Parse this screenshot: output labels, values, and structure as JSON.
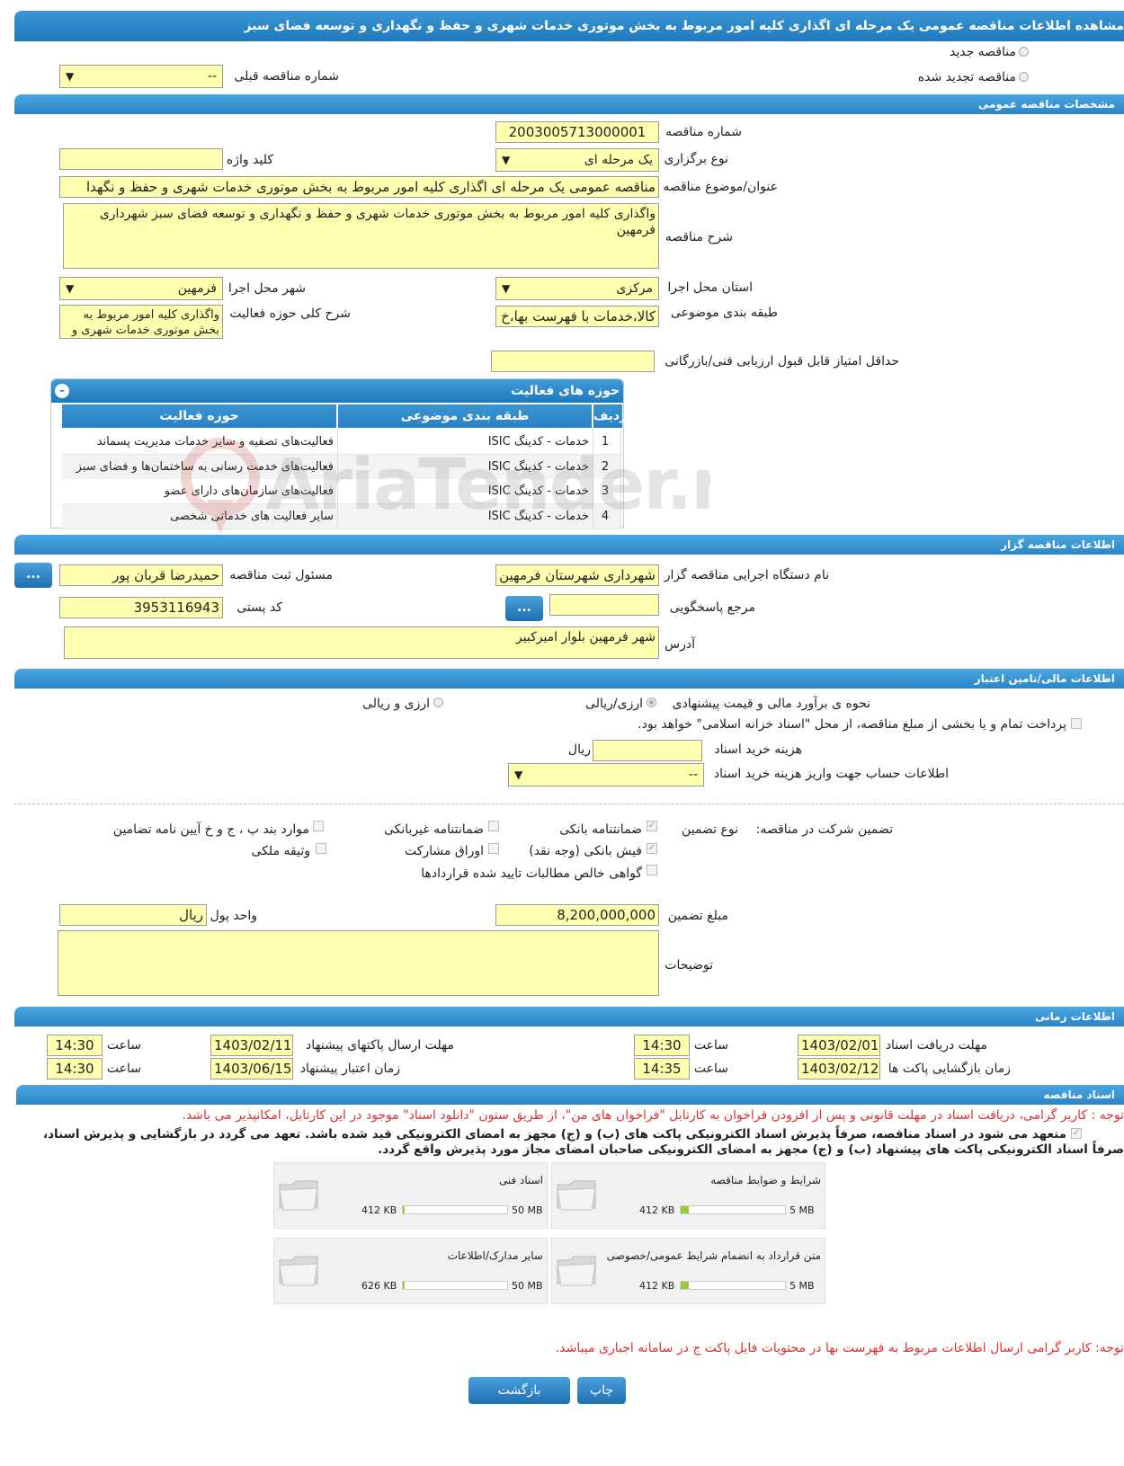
{
  "page": {
    "title": "مشاهده اطلاعات مناقصه عمومی یک مرحله ای اگذاری کلیه امور مربوط به بخش موتوری خدمات شهری و حفظ و نگهداری و توسعه فضای سبز"
  },
  "tender_type": {
    "new_label": "مناقصه جدید",
    "renewed_label": "مناقصه تجدید شده",
    "prev_number_label": "شماره مناقصه قبلی",
    "prev_number_value": "--"
  },
  "general": {
    "section_title": "مشخصات مناقصه عمومی",
    "number_label": "شماره مناقصه",
    "number_value": "2003005713000001",
    "holding_type_label": "نوع برگزاری",
    "holding_type_value": "یک مرحله ای",
    "keyword_label": "کلید واژه",
    "keyword_value": "",
    "subject_label": "عنوان/موضوع مناقصه",
    "subject_value": "مناقصه عمومی یک مرحله ای اگذاری کلیه امور مربوط به بخش موتوری خدمات شهری و حفظ و نگهدا",
    "description_label": "شرح مناقصه",
    "description_value": "واگذاری کلیه امور مربوط به بخش موتوری خدمات شهری و حفظ و نگهداری و توسعه فضای سبز شهرداری فرمهین",
    "province_label": "استان محل اجرا",
    "province_value": "مرکزی",
    "city_label": "شهر محل اجرا",
    "city_value": "فرمهین",
    "category_label": "طبقه بندی موضوعی",
    "category_value": "کالا،خدمات با فهرست بها،خ",
    "activity_desc_label": "شرح کلی حوزه فعالیت",
    "activity_desc_value": "واگذاری کلیه امور مربوط به بخش موتوری خدمات شهری و",
    "min_score_label": "حداقل امتیاز قابل قبول ارزیابی فنی/بازرگانی",
    "min_score_value": ""
  },
  "activities": {
    "title": "حوزه های فعالیت",
    "col_row": "ردیف",
    "col_category": "طبقه بندی موضوعی",
    "col_area": "حوزه فعالیت",
    "rows": [
      {
        "n": "1",
        "category": "خدمات - کدینگ ISIC",
        "area": "فعالیت‌های تصفیه و سایر خدمات مدیریت پسماند"
      },
      {
        "n": "2",
        "category": "خدمات - کدینگ ISIC",
        "area": "فعالیت‌های خدمت رسانی به ساختمان‌ها و فضای سبز"
      },
      {
        "n": "3",
        "category": "خدمات - کدینگ ISIC",
        "area": "فعالیت‌های سازمان‌های دارای عضو"
      },
      {
        "n": "4",
        "category": "خدمات - کدینگ ISIC",
        "area": "سایر فعالیت های خدماتی شخصی"
      }
    ]
  },
  "organizer": {
    "section_title": "اطلاعات مناقصه گزار",
    "org_label": "نام دستگاه اجرایی مناقصه گزار",
    "org_value": "شهرداری شهرستان فرمهین",
    "responsible_label": "مسئول ثبت مناقصه",
    "responsible_value": "حمیدرضا قربان پور",
    "more_button": "...",
    "reference_label": "مرجع پاسخگویی",
    "reference_value": "",
    "postal_label": "کد پستی",
    "postal_value": "3953116943",
    "address_label": "آدرس",
    "address_value": "شهر فرمهین بلوار امیرکبیر"
  },
  "finance": {
    "section_title": "اطلاعات مالی/تامین اعتبار",
    "estimate_label": "نحوه ی برآورد مالی و قیمت پیشنهادی",
    "option_rial": "ارزی/ریالی",
    "option_fx": "ارزی و ریالی",
    "treasury_text": "پرداخت تمام و یا بخشی از مبلغ مناقصه، از محل \"اسناد خزانه اسلامی\" خواهد بود.",
    "doc_fee_label": "هزینه خرید اسناد",
    "doc_fee_value": "",
    "doc_fee_unit": "ریال",
    "account_label": "اطلاعات حساب جهت واریز هزینه خرید اسناد",
    "account_value": "--"
  },
  "guarantee": {
    "label": "تضمین شرکت در مناقصه:",
    "type_label": "نوع تضمین",
    "bank_guarantee": "ضمانتنامه بانکی",
    "non_bank_guarantee": "ضمانتنامه غیربانکی",
    "regulation_items": "موارد بند پ ، ج و خ آیین نامه تضامین",
    "bank_receipt": "فیش بانکی (وجه نقد)",
    "participation_bonds": "اوراق مشارکت",
    "property_deed": "وثیقه ملکی",
    "claims_certificate": "گواهی خالص مطالبات تایید شده قراردادها",
    "amount_label": "مبلغ تضمین",
    "amount_value": "8,200,000,000",
    "currency_label": "واحد پول",
    "currency_value": "ریال",
    "notes_label": "توضیحات",
    "notes_value": ""
  },
  "timing": {
    "section_title": "اطلاعات زمانی",
    "doc_deadline_label": "مهلت دریافت اسناد",
    "doc_deadline_date": "1403/02/01",
    "doc_deadline_time": "14:30",
    "submit_deadline_label": "مهلت ارسال پاکتهای پیشنهاد",
    "submit_deadline_date": "1403/02/11",
    "submit_deadline_time": "14:30",
    "opening_label": "زمان بازگشایی پاکت ها",
    "opening_date": "1403/02/12",
    "opening_time": "14:35",
    "validity_label": "زمان اعتبار پیشنهاد",
    "validity_date": "1403/06/15",
    "validity_time": "14:30",
    "time_label": "ساعت"
  },
  "documents": {
    "section_title": "اسناد مناقصه",
    "notice": "توجه : کاربر گرامی، دریافت اسناد در مهلت قانونی و پس از افزودن فراخوان به کارتابل \"فراخوان های من\"، از طریق ستون \"دانلود اسناد\" موجود در این کارتابل، امکانپذیر می باشد.",
    "pledge_line1": "متعهد می شود در اسناد مناقصه، صرفاً پذیرش اسناد الکترونیکی پاکت های (ب) و (ج) مجهز به امضای الکترونیکی قید شده باشد. تعهد می گردد در بازگشایی و پذیرش اسناد،",
    "pledge_line2": "صرفاً اسناد الکترونیکی پاکت های پیشنهاد (ب) و (ج) مجهز به امضای الکترونیکی صاحبان امضای مجاز مورد پذیرش واقع گردد.",
    "files": [
      {
        "name": "شرایط و ضوابط مناقصه",
        "size": "412 KB",
        "max": "5 MB",
        "fill": 0.08
      },
      {
        "name": "اسناد فنی",
        "size": "412 KB",
        "max": "50 MB",
        "fill": 0.01
      },
      {
        "name": "متن قرارداد به انضمام شرایط عمومی/خصوصی",
        "size": "412 KB",
        "max": "5 MB",
        "fill": 0.08
      },
      {
        "name": "سایر مدارک/اطلاعات",
        "size": "626 KB",
        "max": "50 MB",
        "fill": 0.01
      }
    ],
    "footer_notice": "توجه: کاربر گرامی ارسال اطلاعات مربوط به فهرست بها در محتویات فایل پاکت ج در سامانه اجباری میباشد."
  },
  "actions": {
    "print": "چاپ",
    "back": "بازگشت"
  },
  "watermark": "AriaTender.neT"
}
